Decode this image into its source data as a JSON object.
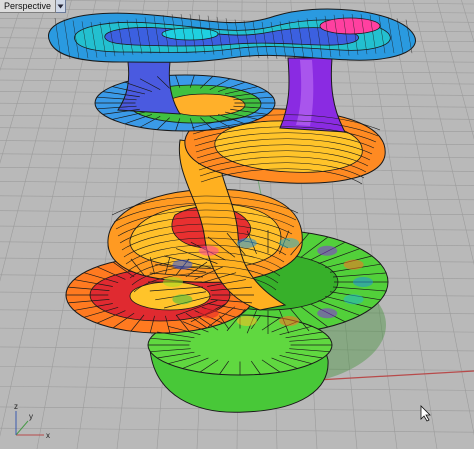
{
  "viewport": {
    "label": "Perspective",
    "menu_icon": "triangle-down-icon",
    "background_color": "#b9b9b9",
    "grid_color": "#9c9c9c",
    "x_axis_color": "#b84a4a",
    "y_axis_color": "#4a9a4a"
  },
  "axis_widget": {
    "x_label": "x",
    "y_label": "y",
    "z_label": "z"
  },
  "model": {
    "colors": [
      "#1f8fe0",
      "#23b8c8",
      "#8a2be2",
      "#ff6f20",
      "#ffc020",
      "#e8202a",
      "#40c040",
      "#a0e020",
      "#3050e0",
      "#ff40a0"
    ]
  }
}
